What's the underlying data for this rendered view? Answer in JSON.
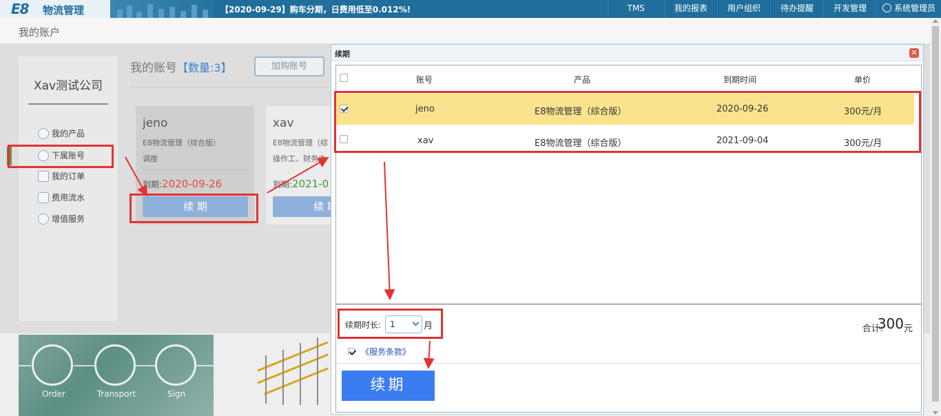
{
  "app": {
    "logo_mark": "E8",
    "logo_text": "物流管理",
    "notice": "【2020-09-29】购车分期，日费用低至0.012%!"
  },
  "topnav": [
    {
      "label": "TMS"
    },
    {
      "label": "我的报表"
    },
    {
      "label": "用户组织"
    },
    {
      "label": "待办提醒"
    },
    {
      "label": "开发管理"
    },
    {
      "label": "系统管理员"
    }
  ],
  "page": {
    "title": "我的账户"
  },
  "sidebar": {
    "company": "Xav测试公司",
    "items": [
      {
        "label": "我的产品",
        "icon": "box-icon"
      },
      {
        "label": "下属账号",
        "icon": "user-icon"
      },
      {
        "label": "我的订单",
        "icon": "order-icon"
      },
      {
        "label": "费用流水",
        "icon": "wallet-icon"
      },
      {
        "label": "增值服务",
        "icon": "chart-icon"
      }
    ]
  },
  "accounts": {
    "title": "我的账号",
    "count_label": "【数量:3】",
    "buy_button": "加购账号",
    "cards": [
      {
        "name": "jeno",
        "product": "E8物流管理（综合版）",
        "role": "调度",
        "expire_label": "到期:",
        "expire_date": "2020-09-26",
        "button": "续 期"
      },
      {
        "name": "xav",
        "product": "E8物流管理（综",
        "role": "操作工、财务主",
        "expire_label": "到期:",
        "expire_date": "2021-0",
        "button": "续 期"
      }
    ]
  },
  "banner": {
    "labels": [
      "Order",
      "Transport",
      "Sign"
    ]
  },
  "modal": {
    "title": "续期",
    "close": "✕",
    "columns": [
      "账号",
      "产品",
      "到期时间",
      "单价"
    ],
    "rows": [
      {
        "account": "jeno",
        "product": "E8物流管理（综合版）",
        "expire": "2020-09-26",
        "price": "300元/月",
        "checked": true
      },
      {
        "account": "xav",
        "product": "E8物流管理（综合版）",
        "expire": "2021-09-04",
        "price": "300元/月",
        "checked": false
      }
    ],
    "duration_label": "续期时长:",
    "duration_value": "1",
    "duration_unit": "月",
    "total_label": "合计:",
    "total_value": "300",
    "total_unit": "元",
    "terms": "《服务条款》",
    "renew_button": "续期"
  },
  "colors": {
    "topbar": "#1f6e9b",
    "highlight": "#e23232",
    "selected_row": "#fbe38e",
    "primary_button": "#3b7df0"
  }
}
